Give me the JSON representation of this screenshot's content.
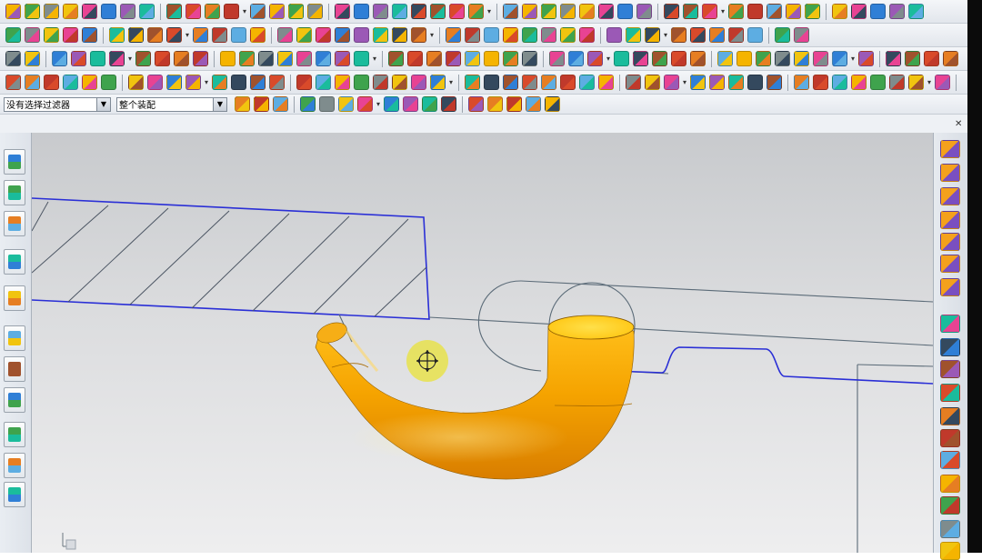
{
  "filter_bar": {
    "selection_filter": "没有选择过滤器",
    "assembly_scope": "整个装配"
  },
  "colors": {
    "tube": "#f5a300",
    "tube_top": "#ffd21c",
    "outline_blue": "#2a2fd6",
    "outline_grey": "#5b6b78",
    "cursor": "#e8e24c"
  },
  "icons": {
    "toolbar": [
      "new-file-icon",
      "open-folder-icon",
      "save-icon",
      "cylinder-icon",
      "sphere-icon",
      "blend-icon",
      "extrude-icon",
      "revolve-icon",
      "chamfer-icon",
      "hole-icon",
      "shell-icon",
      "pattern-icon",
      "sketch-icon",
      "datum-plane-icon",
      "datum-axis-icon",
      "measure-icon",
      "layer-icon",
      "view-icon"
    ],
    "viewport_cursor": "move-crosshair-icon"
  }
}
